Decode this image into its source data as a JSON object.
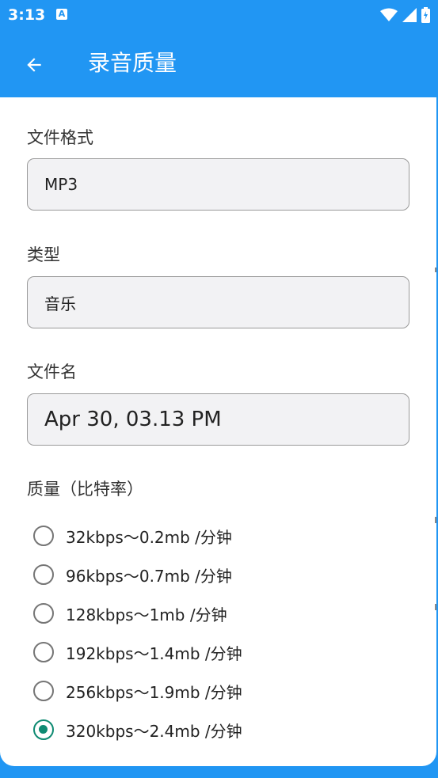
{
  "status_bar": {
    "time": "3:13",
    "notification": "A"
  },
  "app_bar": {
    "title": "录音质量"
  },
  "file_format": {
    "label": "文件格式",
    "value": "MP3"
  },
  "type": {
    "label": "类型",
    "value": "音乐"
  },
  "file_name": {
    "label": "文件名",
    "value": "Apr 30, 03.13 PM"
  },
  "quality": {
    "label": "质量（比特率）",
    "options": [
      {
        "label": "32kbps～0.2mb /分钟",
        "selected": false
      },
      {
        "label": "96kbps～0.7mb /分钟",
        "selected": false
      },
      {
        "label": "128kbps～1mb /分钟",
        "selected": false
      },
      {
        "label": "192kbps～1.4mb /分钟",
        "selected": false
      },
      {
        "label": "256kbps～1.9mb /分钟",
        "selected": false
      },
      {
        "label": "320kbps～2.4mb /分钟",
        "selected": true
      }
    ]
  },
  "colors": {
    "primary": "#2196F3",
    "accent": "#0E8A72",
    "field_bg": "#F2F2F4"
  }
}
